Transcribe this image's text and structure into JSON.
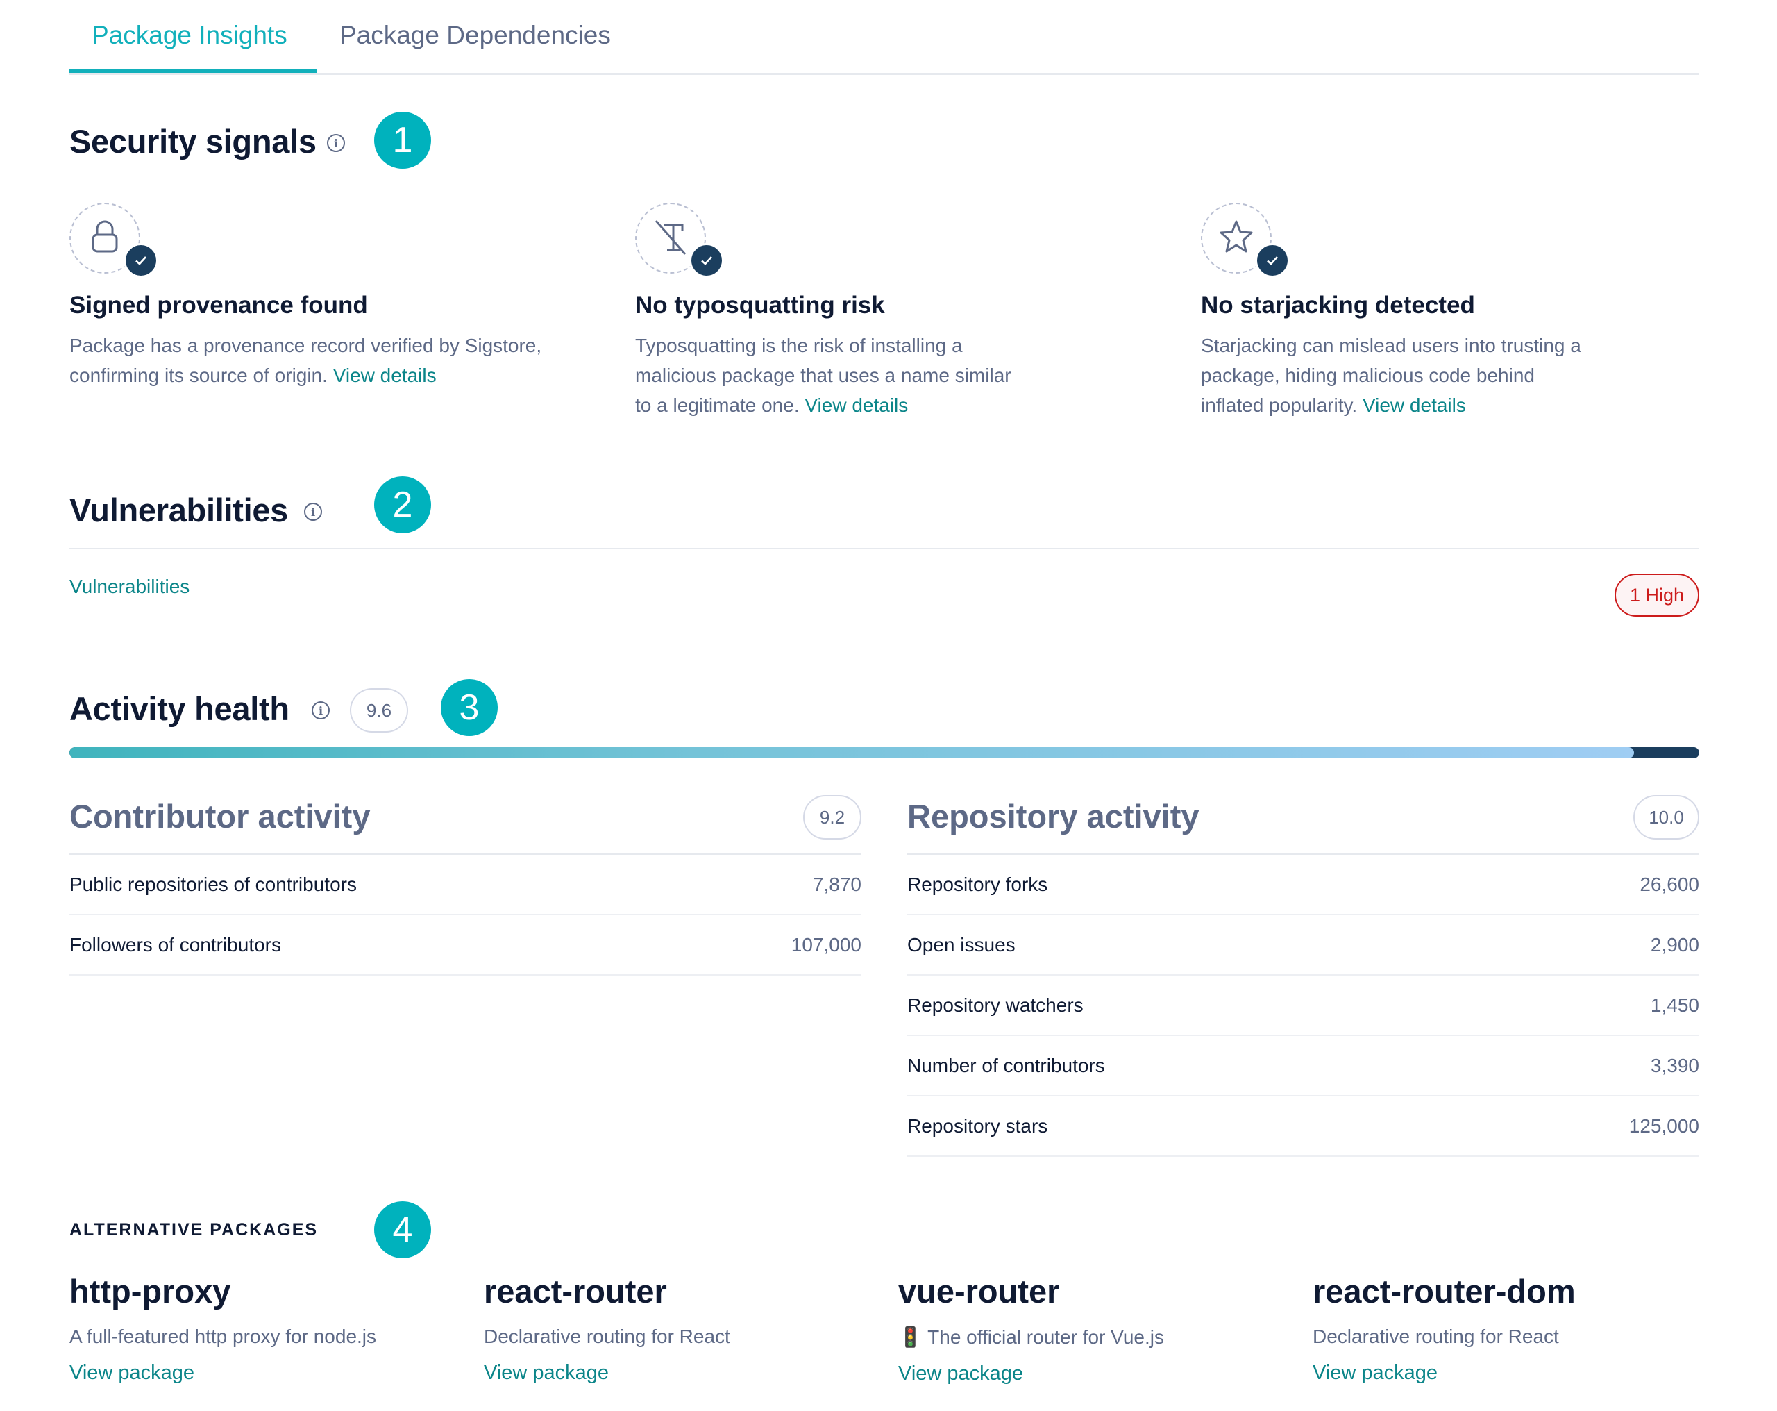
{
  "tabs": [
    {
      "label": "Package Insights",
      "active": true
    },
    {
      "label": "Package Dependencies",
      "active": false
    }
  ],
  "security": {
    "title": "Security signals",
    "step": "1",
    "signals": [
      {
        "icon": "lock-icon",
        "title": "Signed provenance found",
        "description": "Package has a provenance record verified by Sigstore, confirming its source of origin.",
        "link": "View details",
        "status": "passed"
      },
      {
        "icon": "typosquat-icon",
        "title": "No typosquatting risk",
        "description": "Typosquatting is the risk of installing a malicious package that uses a name similar to a legitimate one.",
        "link": "View details",
        "status": "passed"
      },
      {
        "icon": "star-icon",
        "title": "No starjacking detected",
        "description": "Starjacking can mislead users into trusting a package, hiding malicious code behind inflated popularity.",
        "link": "View details",
        "status": "passed"
      }
    ]
  },
  "vulnerabilities": {
    "title": "Vulnerabilities",
    "step": "2",
    "link": "Vulnerabilities",
    "badge": "1 High",
    "badge_color": "#cc1b1b"
  },
  "activity": {
    "title": "Activity health",
    "score": "9.6",
    "score_fraction": 0.96,
    "step": "3",
    "contributor": {
      "title": "Contributor activity",
      "score": "9.2",
      "rows": [
        {
          "label": "Public repositories of contributors",
          "value": "7,870"
        },
        {
          "label": "Followers of contributors",
          "value": "107,000"
        }
      ]
    },
    "repository": {
      "title": "Repository activity",
      "score": "10.0",
      "rows": [
        {
          "label": "Repository forks",
          "value": "26,600"
        },
        {
          "label": "Open issues",
          "value": "2,900"
        },
        {
          "label": "Repository watchers",
          "value": "1,450"
        },
        {
          "label": "Number of contributors",
          "value": "3,390"
        },
        {
          "label": "Repository stars",
          "value": "125,000"
        }
      ]
    }
  },
  "alternatives": {
    "label": "ALTERNATIVE PACKAGES",
    "step": "4",
    "packages": [
      {
        "name": "http-proxy",
        "description": "A full-featured http proxy for node.js",
        "link": "View package"
      },
      {
        "name": "react-router",
        "description": "Declarative routing for React",
        "link": "View package"
      },
      {
        "name": "vue-router",
        "description": "🚦 The official router for Vue.js",
        "link": "View package"
      },
      {
        "name": "react-router-dom",
        "description": "Declarative routing for React",
        "link": "View package"
      }
    ]
  },
  "colors": {
    "accent": "#00b2bd",
    "link": "#0b8589",
    "badge_dark": "#1b3e5e",
    "high": "#cc1b1b"
  }
}
